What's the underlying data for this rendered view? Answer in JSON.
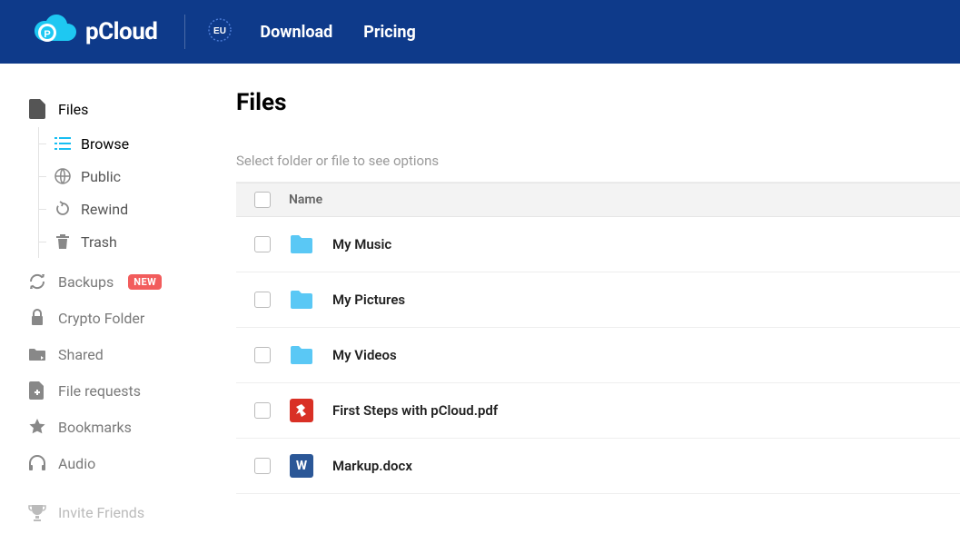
{
  "brand": "pCloud",
  "nav": {
    "download": "Download",
    "pricing": "Pricing"
  },
  "sidebar": {
    "files": "Files",
    "browse": "Browse",
    "public": "Public",
    "rewind": "Rewind",
    "trash": "Trash",
    "backups": "Backups",
    "backups_badge": "NEW",
    "crypto": "Crypto Folder",
    "shared": "Shared",
    "file_requests": "File requests",
    "bookmarks": "Bookmarks",
    "audio": "Audio",
    "invite": "Invite Friends"
  },
  "main": {
    "title": "Files",
    "hint": "Select folder or file to see options",
    "col_name": "Name",
    "rows": [
      {
        "type": "folder",
        "name": "My Music"
      },
      {
        "type": "folder",
        "name": "My Pictures"
      },
      {
        "type": "folder",
        "name": "My Videos"
      },
      {
        "type": "pdf",
        "name": "First Steps with pCloud.pdf"
      },
      {
        "type": "docx",
        "name": "Markup.docx"
      }
    ]
  }
}
